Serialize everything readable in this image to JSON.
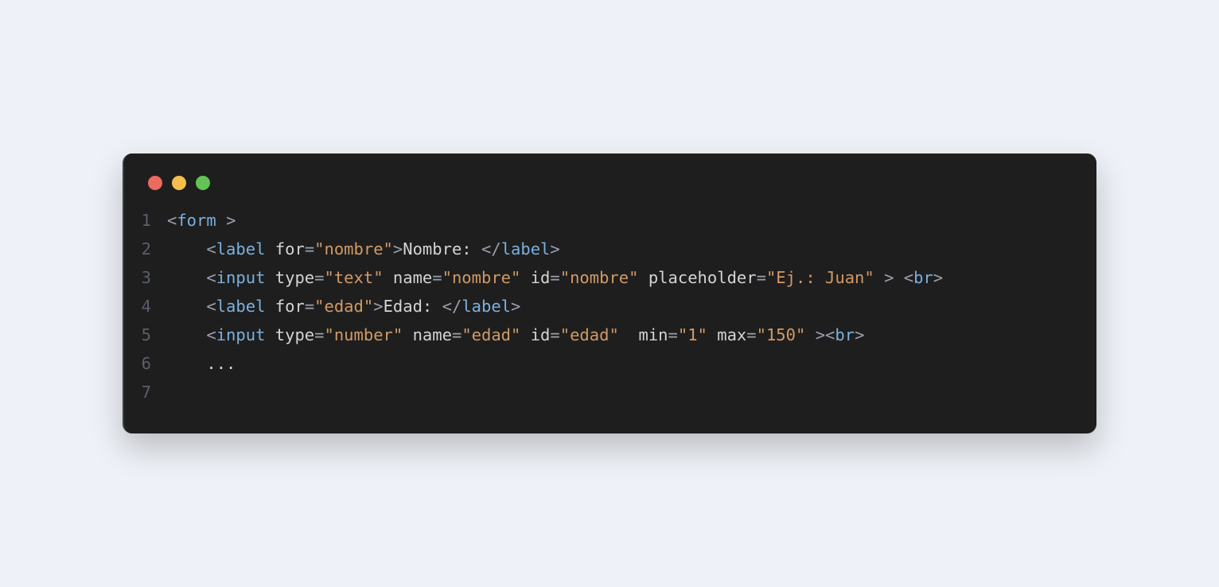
{
  "code": {
    "lines": [
      {
        "num": "1",
        "tokens": [
          {
            "t": "punct",
            "v": "<"
          },
          {
            "t": "tag",
            "v": "form"
          },
          {
            "t": "text",
            "v": " "
          },
          {
            "t": "punct",
            "v": ">"
          }
        ],
        "indent": 0
      },
      {
        "num": "2",
        "tokens": [
          {
            "t": "punct",
            "v": "<"
          },
          {
            "t": "tag",
            "v": "label"
          },
          {
            "t": "text",
            "v": " "
          },
          {
            "t": "attr",
            "v": "for"
          },
          {
            "t": "eq",
            "v": "="
          },
          {
            "t": "str",
            "v": "\"nombre\""
          },
          {
            "t": "punct",
            "v": ">"
          },
          {
            "t": "text",
            "v": "Nombre: "
          },
          {
            "t": "punct",
            "v": "</"
          },
          {
            "t": "tag",
            "v": "label"
          },
          {
            "t": "punct",
            "v": ">"
          }
        ],
        "indent": 1
      },
      {
        "num": "3",
        "tokens": [
          {
            "t": "punct",
            "v": "<"
          },
          {
            "t": "tag",
            "v": "input"
          },
          {
            "t": "text",
            "v": " "
          },
          {
            "t": "attr",
            "v": "type"
          },
          {
            "t": "eq",
            "v": "="
          },
          {
            "t": "str",
            "v": "\"text\""
          },
          {
            "t": "text",
            "v": " "
          },
          {
            "t": "attr",
            "v": "name"
          },
          {
            "t": "eq",
            "v": "="
          },
          {
            "t": "str",
            "v": "\"nombre\""
          },
          {
            "t": "text",
            "v": " "
          },
          {
            "t": "attr",
            "v": "id"
          },
          {
            "t": "eq",
            "v": "="
          },
          {
            "t": "str",
            "v": "\"nombre\""
          },
          {
            "t": "text",
            "v": " "
          },
          {
            "t": "attr",
            "v": "placeholder"
          },
          {
            "t": "eq",
            "v": "="
          },
          {
            "t": "str",
            "v": "\"Ej.: Juan\""
          },
          {
            "t": "text",
            "v": " "
          },
          {
            "t": "punct",
            "v": ">"
          },
          {
            "t": "text",
            "v": " "
          },
          {
            "t": "punct",
            "v": "<"
          },
          {
            "t": "tag",
            "v": "br"
          },
          {
            "t": "punct",
            "v": ">"
          }
        ],
        "indent": 1
      },
      {
        "num": "4",
        "tokens": [
          {
            "t": "punct",
            "v": "<"
          },
          {
            "t": "tag",
            "v": "label"
          },
          {
            "t": "text",
            "v": " "
          },
          {
            "t": "attr",
            "v": "for"
          },
          {
            "t": "eq",
            "v": "="
          },
          {
            "t": "str",
            "v": "\"edad\""
          },
          {
            "t": "punct",
            "v": ">"
          },
          {
            "t": "text",
            "v": "Edad: "
          },
          {
            "t": "punct",
            "v": "</"
          },
          {
            "t": "tag",
            "v": "label"
          },
          {
            "t": "punct",
            "v": ">"
          }
        ],
        "indent": 1
      },
      {
        "num": "5",
        "tokens": [
          {
            "t": "punct",
            "v": "<"
          },
          {
            "t": "tag",
            "v": "input"
          },
          {
            "t": "text",
            "v": " "
          },
          {
            "t": "attr",
            "v": "type"
          },
          {
            "t": "eq",
            "v": "="
          },
          {
            "t": "str",
            "v": "\"number\""
          },
          {
            "t": "text",
            "v": " "
          },
          {
            "t": "attr",
            "v": "name"
          },
          {
            "t": "eq",
            "v": "="
          },
          {
            "t": "str",
            "v": "\"edad\""
          },
          {
            "t": "text",
            "v": " "
          },
          {
            "t": "attr",
            "v": "id"
          },
          {
            "t": "eq",
            "v": "="
          },
          {
            "t": "str",
            "v": "\"edad\""
          },
          {
            "t": "text",
            "v": "  "
          },
          {
            "t": "attr",
            "v": "min"
          },
          {
            "t": "eq",
            "v": "="
          },
          {
            "t": "str",
            "v": "\"1\""
          },
          {
            "t": "text",
            "v": " "
          },
          {
            "t": "attr",
            "v": "max"
          },
          {
            "t": "eq",
            "v": "="
          },
          {
            "t": "str",
            "v": "\"150\""
          },
          {
            "t": "text",
            "v": " "
          },
          {
            "t": "punct",
            "v": ">"
          },
          {
            "t": "punct",
            "v": "<"
          },
          {
            "t": "tag",
            "v": "br"
          },
          {
            "t": "punct",
            "v": ">"
          }
        ],
        "indent": 1
      },
      {
        "num": "6",
        "tokens": [
          {
            "t": "text",
            "v": "..."
          }
        ],
        "indent": 1
      },
      {
        "num": "7",
        "tokens": [],
        "indent": 0
      }
    ]
  }
}
